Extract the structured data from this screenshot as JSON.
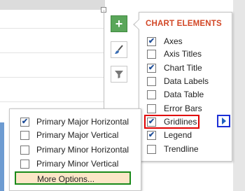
{
  "panel": {
    "title": "CHART ELEMENTS",
    "items": [
      {
        "label": "Axes",
        "checked": true
      },
      {
        "label": "Axis Titles",
        "checked": false
      },
      {
        "label": "Chart Title",
        "checked": true
      },
      {
        "label": "Data Labels",
        "checked": false
      },
      {
        "label": "Data Table",
        "checked": false
      },
      {
        "label": "Error Bars",
        "checked": false
      },
      {
        "label": "Gridlines",
        "checked": true
      },
      {
        "label": "Legend",
        "checked": true
      },
      {
        "label": "Trendline",
        "checked": false
      }
    ]
  },
  "buttons": {
    "add_icon": "plus-icon",
    "style_icon": "paintbrush-icon",
    "filter_icon": "funnel-icon",
    "add_glyph": "+"
  },
  "submenu": {
    "items": [
      {
        "label": "Primary Major Horizontal",
        "checked": true
      },
      {
        "label": "Primary Major Vertical",
        "checked": false
      },
      {
        "label": "Primary Minor Horizontal",
        "checked": false
      },
      {
        "label": "Primary Minor Vertical",
        "checked": false
      }
    ],
    "more_options": "More Options..."
  },
  "colors": {
    "accent_title": "#d24726",
    "highlight_red": "#e00000",
    "highlight_blue": "#1c2fd6",
    "highlight_green": "#1a8a1a",
    "hover_bg": "#fbe6c7",
    "plus_button": "#5aa65a"
  }
}
